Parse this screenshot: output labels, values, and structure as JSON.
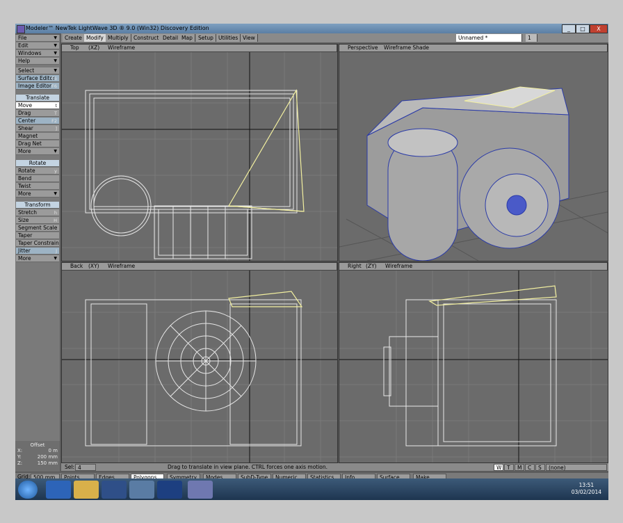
{
  "window": {
    "title": "Modeler™ NewTek LightWave 3D ® 9.0 (Win32) Discovery Edition",
    "controls": [
      "_",
      "□",
      "X"
    ]
  },
  "menu": {
    "tabs": [
      "Create",
      "Modify",
      "Multiply",
      "Construct",
      "Detail",
      "Map",
      "Setup",
      "Utilities",
      "View"
    ],
    "active_tab": "Modify",
    "object_name": "Unnamed *",
    "layer_number": "1"
  },
  "sidebar": {
    "top": [
      "File",
      "Edit",
      "Windows",
      "Help"
    ],
    "select": "Select",
    "surface_editor": "Surface Editor",
    "surface_editor_key": "F5",
    "image_editor": "Image Editor",
    "image_editor_key": "F6",
    "translate_header": "Translate",
    "translate": [
      {
        "label": "Move",
        "key": "t"
      },
      {
        "label": "Drag",
        "key": "T"
      },
      {
        "label": "Center",
        "key": "F2"
      },
      {
        "label": "Shear",
        "key": "]"
      },
      {
        "label": "Magnet",
        "key": ""
      },
      {
        "label": "Drag Net",
        "key": ""
      },
      {
        "label": "More",
        "key": ""
      }
    ],
    "rotate_header": "Rotate",
    "rotate": [
      {
        "label": "Rotate",
        "key": "y"
      },
      {
        "label": "Bend",
        "key": ""
      },
      {
        "label": "Twist",
        "key": ""
      },
      {
        "label": "More",
        "key": ""
      }
    ],
    "transform_header": "Transform",
    "transform": [
      {
        "label": "Stretch",
        "key": "h"
      },
      {
        "label": "Size",
        "key": "H"
      },
      {
        "label": "Segment Scale",
        "key": ""
      },
      {
        "label": "Taper",
        "key": ""
      },
      {
        "label": "Taper Constrain",
        "key": ""
      },
      {
        "label": "Jitter",
        "key": "J"
      },
      {
        "label": "More",
        "key": ""
      }
    ],
    "offset": {
      "title": "Offset",
      "x": "0 m",
      "y": "200 mm",
      "z": "150 mm",
      "x_label": "X:",
      "y_label": "Y:",
      "z_label": "Z:"
    }
  },
  "viewports": {
    "top_left": {
      "view": "Top",
      "axes": "(XZ)",
      "mode": "Wireframe"
    },
    "top_right": {
      "view": "Perspective",
      "mode": "Wireframe Shade"
    },
    "bottom_left": {
      "view": "Back",
      "axes": "(XY)",
      "mode": "Wireframe"
    },
    "bottom_right": {
      "view": "Right",
      "axes": "(ZY)",
      "mode": "Wireframe"
    }
  },
  "status": {
    "sel_label": "Sel:",
    "sel_value": "4",
    "hint": "Drag to translate in view plane. CTRL forces one axis motion.",
    "buttons": [
      "W",
      "T",
      "M",
      "C",
      "S"
    ],
    "surface": "(none)"
  },
  "bottombar": {
    "grid_label": "Grid:",
    "grid_value": "500 mm",
    "items": [
      "Points",
      "Edges",
      "Polygons",
      "Symmetry",
      "Modes",
      "SubD-Type",
      "Numeric",
      "Statistics",
      "Info",
      "Surface",
      "Make"
    ]
  },
  "taskbar": {
    "time": "13:51",
    "date": "03/02/2014",
    "apps": [
      "start-orb",
      "internet-explorer",
      "file-explorer",
      "media-player",
      "chrome",
      "photoshop",
      "lightwave"
    ]
  },
  "colors": {
    "viewport_bg": "#6b6b6b",
    "grid_line": "#7a7a7a",
    "wire": "#e8e8e8",
    "selected_wire": "#f3f0a0",
    "shade_blue": "#2a3aa8"
  }
}
